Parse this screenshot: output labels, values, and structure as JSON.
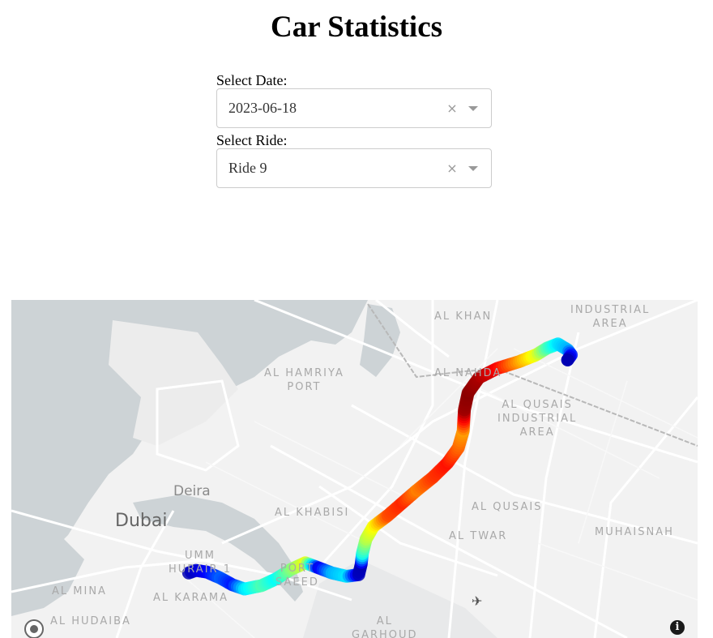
{
  "page": {
    "title": "Car Statistics"
  },
  "filters": {
    "date": {
      "label": "Select Date:",
      "value": "2023-06-18",
      "clear_icon": "×"
    },
    "ride": {
      "label": "Select Ride:",
      "value": "Ride 9",
      "clear_icon": "×"
    }
  },
  "map": {
    "style": "light",
    "labels": [
      {
        "text": "AL KHAN",
        "kind": "area"
      },
      {
        "text": "INDUSTRIAL\nAREA",
        "kind": "area"
      },
      {
        "text": "AL HAMRIYA\nPORT",
        "kind": "area"
      },
      {
        "text": "AL NAHDA",
        "kind": "area"
      },
      {
        "text": "AL QUSAIS\nINDUSTRIAL\nAREA",
        "kind": "area"
      },
      {
        "text": "Deira",
        "kind": "town"
      },
      {
        "text": "Dubai",
        "kind": "city"
      },
      {
        "text": "AL KHABISI",
        "kind": "area"
      },
      {
        "text": "AL QUSAIS",
        "kind": "area"
      },
      {
        "text": "AL TWAR",
        "kind": "area"
      },
      {
        "text": "MUHAISNAH",
        "kind": "area"
      },
      {
        "text": "UMM\nHURAIR 1",
        "kind": "area"
      },
      {
        "text": "PORT\nSAEED",
        "kind": "area"
      },
      {
        "text": "AL MINA",
        "kind": "area"
      },
      {
        "text": "AL KARAMA",
        "kind": "area"
      },
      {
        "text": "AL HUDAIBA",
        "kind": "area"
      },
      {
        "text": "AL\nGARHOUD",
        "kind": "area"
      }
    ],
    "info_icon": "i",
    "airport_icon": "✈",
    "route": {
      "color_scale": "jet",
      "points": [
        {
          "lng": 55.3086,
          "lat": 25.2512,
          "v": 0.05
        },
        {
          "lng": 55.3092,
          "lat": 25.2515,
          "v": 0.08
        },
        {
          "lng": 55.3101,
          "lat": 25.2513,
          "v": 0.12
        },
        {
          "lng": 55.3112,
          "lat": 25.2506,
          "v": 0.22
        },
        {
          "lng": 55.3122,
          "lat": 25.2498,
          "v": 0.15
        },
        {
          "lng": 55.3132,
          "lat": 25.2493,
          "v": 0.35
        },
        {
          "lng": 55.3146,
          "lat": 25.2497,
          "v": 0.45
        },
        {
          "lng": 55.3158,
          "lat": 25.2505,
          "v": 0.38
        },
        {
          "lng": 55.317,
          "lat": 25.2516,
          "v": 0.5
        },
        {
          "lng": 55.3182,
          "lat": 25.2524,
          "v": 0.6
        },
        {
          "lng": 55.3193,
          "lat": 25.2518,
          "v": 0.1
        },
        {
          "lng": 55.3204,
          "lat": 25.2512,
          "v": 0.3
        },
        {
          "lng": 55.3216,
          "lat": 25.2508,
          "v": 0.35
        },
        {
          "lng": 55.3226,
          "lat": 25.251,
          "v": 0.06
        },
        {
          "lng": 55.3228,
          "lat": 25.2522,
          "v": 0.05
        },
        {
          "lng": 55.3229,
          "lat": 25.2535,
          "v": 0.4
        },
        {
          "lng": 55.3232,
          "lat": 25.2552,
          "v": 0.55
        },
        {
          "lng": 55.3238,
          "lat": 25.2567,
          "v": 0.62
        },
        {
          "lng": 55.325,
          "lat": 25.258,
          "v": 0.8
        },
        {
          "lng": 55.3262,
          "lat": 25.2595,
          "v": 0.84
        },
        {
          "lng": 55.3274,
          "lat": 25.261,
          "v": 0.75
        },
        {
          "lng": 55.3287,
          "lat": 25.2625,
          "v": 0.82
        },
        {
          "lng": 55.3299,
          "lat": 25.2642,
          "v": 0.86
        },
        {
          "lng": 55.3308,
          "lat": 25.266,
          "v": 0.78
        },
        {
          "lng": 55.3312,
          "lat": 25.268,
          "v": 0.72
        },
        {
          "lng": 55.3313,
          "lat": 25.2705,
          "v": 0.97
        },
        {
          "lng": 55.3316,
          "lat": 25.2725,
          "v": 0.99
        },
        {
          "lng": 55.3325,
          "lat": 25.2743,
          "v": 0.96
        },
        {
          "lng": 55.334,
          "lat": 25.2754,
          "v": 0.88
        },
        {
          "lng": 55.3358,
          "lat": 25.2762,
          "v": 0.72
        },
        {
          "lng": 55.3372,
          "lat": 25.277,
          "v": 0.6
        },
        {
          "lng": 55.3381,
          "lat": 25.2778,
          "v": 0.45
        },
        {
          "lng": 55.339,
          "lat": 25.2783,
          "v": 0.35
        },
        {
          "lng": 55.3398,
          "lat": 25.2776,
          "v": 0.3
        },
        {
          "lng": 55.3401,
          "lat": 25.277,
          "v": 0.15
        },
        {
          "lng": 55.3398,
          "lat": 25.2764,
          "v": 0.05
        }
      ]
    }
  }
}
